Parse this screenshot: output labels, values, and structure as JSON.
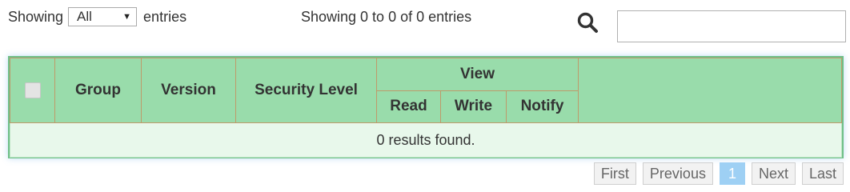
{
  "length_control": {
    "prefix": "Showing",
    "selected": "All",
    "suffix": "entries"
  },
  "summary": "Showing 0 to 0 of 0 entries",
  "search": {
    "icon": "search-icon",
    "value": "",
    "placeholder": ""
  },
  "table": {
    "columns": {
      "group": "Group",
      "version": "Version",
      "security_level": "Security Level",
      "view": "View",
      "read": "Read",
      "write": "Write",
      "notify": "Notify"
    },
    "empty_message": "0 results found."
  },
  "pagination": {
    "first": "First",
    "previous": "Previous",
    "current": "1",
    "next": "Next",
    "last": "Last"
  },
  "colors": {
    "header_bg": "#99dcab",
    "header_border": "#bf9a6a",
    "empty_row_bg": "#e8f8eb",
    "active_page": "#9ed0f4"
  }
}
